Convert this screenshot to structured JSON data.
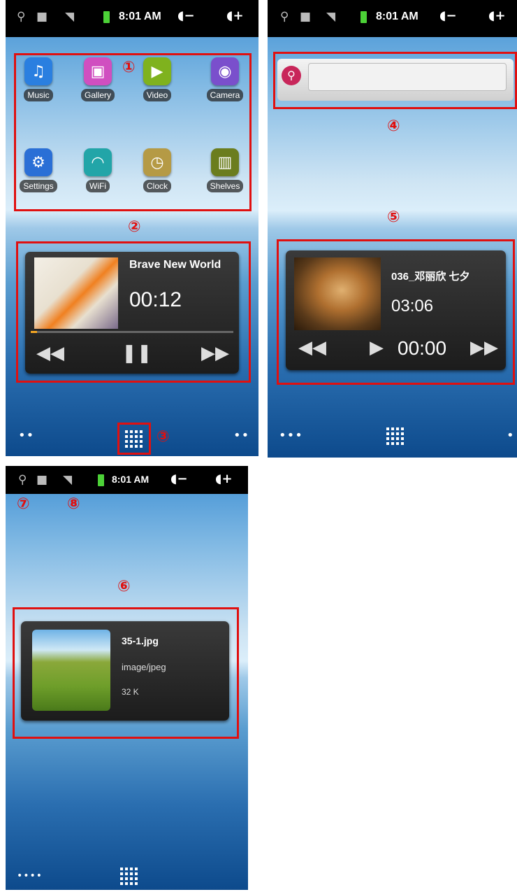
{
  "status_bar": {
    "time": "8:01 AM",
    "volume_down": "◖−",
    "volume_up": "◖+"
  },
  "screen1": {
    "apps": [
      {
        "label": "Music",
        "icon": "music-icon",
        "color": "#2a7fe0"
      },
      {
        "label": "Gallery",
        "icon": "gallery-icon",
        "color": "#d04fc0"
      },
      {
        "label": "Video",
        "icon": "video-icon",
        "color": "#7fb21e"
      },
      {
        "label": "Camera",
        "icon": "camera-icon",
        "color": "#7a4fcc"
      },
      {
        "label": "Settings",
        "icon": "settings-icon",
        "color": "#2a6fd6"
      },
      {
        "label": "WiFi",
        "icon": "wifi-icon",
        "color": "#22a5a8"
      },
      {
        "label": "Clock",
        "icon": "clock-icon",
        "color": "#b59a45"
      },
      {
        "label": "Shelves",
        "icon": "shelves-icon",
        "color": "#6b7d1e"
      }
    ],
    "music_widget": {
      "title": "Brave New World",
      "time": "00:12",
      "progress": 0.03
    }
  },
  "screen2": {
    "search_placeholder": "",
    "music_widget": {
      "title": "036_邓丽欣 七夕",
      "duration": "03:06",
      "position": "00:00"
    }
  },
  "screen3": {
    "photo_widget": {
      "filename": "35-1.jpg",
      "mime": "image/jpeg",
      "size": "32 K"
    }
  },
  "annotations": [
    "①",
    "②",
    "③",
    "④",
    "⑤",
    "⑥",
    "⑦",
    "⑧"
  ]
}
